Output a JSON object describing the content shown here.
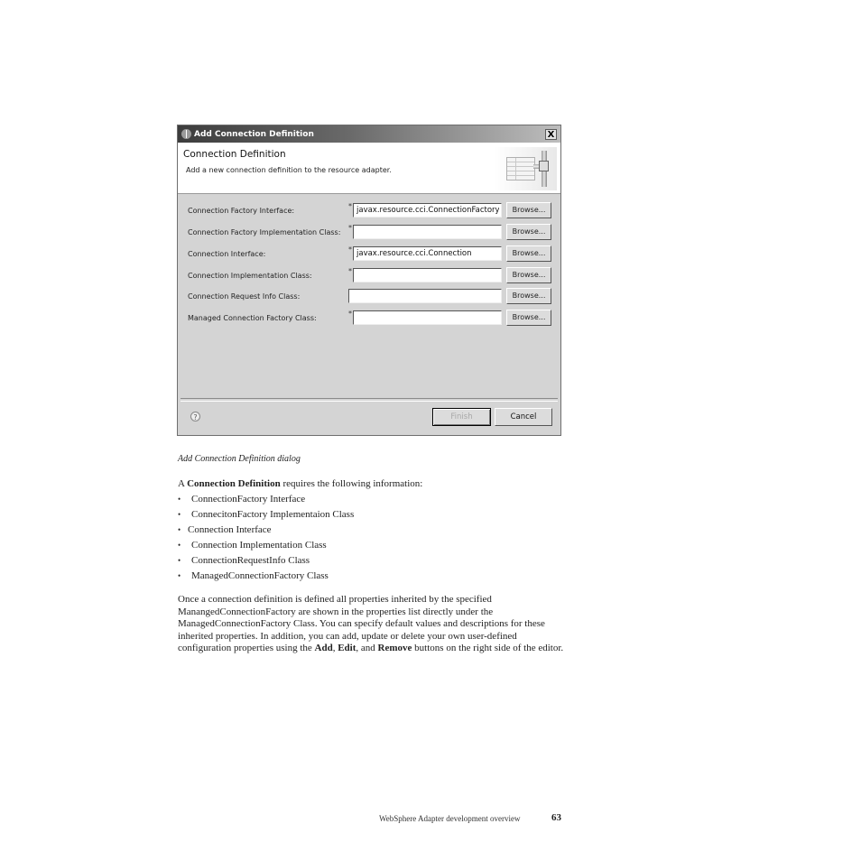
{
  "dialog": {
    "title": "Add Connection Definition",
    "close_label": "X",
    "banner": {
      "title": "Connection Definition",
      "description": "Add a new connection definition to the resource adapter."
    },
    "fields": [
      {
        "label": "Connection Factory Interface:",
        "required": true,
        "value": "javax.resource.cci.ConnectionFactory",
        "button": "Browse..."
      },
      {
        "label": "Connection Factory Implementation Class:",
        "required": true,
        "value": "",
        "button": "Browse..."
      },
      {
        "label": "Connection Interface:",
        "required": true,
        "value": "javax.resource.cci.Connection",
        "button": "Browse..."
      },
      {
        "label": "Connection Implementation Class:",
        "required": true,
        "value": "",
        "button": "Browse..."
      },
      {
        "label": "Connection Request Info Class:",
        "required": false,
        "value": "",
        "button": "Browse..."
      },
      {
        "label": "Managed Connection Factory Class:",
        "required": true,
        "value": "",
        "button": "Browse..."
      }
    ],
    "required_marker": "*",
    "help_label": "?",
    "finish_label": "Finish",
    "cancel_label": "Cancel"
  },
  "document": {
    "caption": "Add Connection Definition dialog",
    "intro_prefix": "A ",
    "intro_bold": "Connection Definition",
    "intro_suffix": " requires the following information:",
    "list": [
      "ConnectionFactory Interface",
      "ConnecitonFactory Implementaion Class",
      "Connection Interface",
      "Connection Implementation Class",
      "ConnectionRequestInfo Class",
      "ManagedConnectionFactory Class"
    ],
    "paragraph": {
      "text1": "Once a connection definition is defined all properties inherited by the specified ManangedConnectionFactory are shown in the properties list directly under the ManagedConnectionFactory Class. You can specify default values and descriptions for these inherited properties. In addition, you can add, update or delete your own user-defined configuration properties using the ",
      "bold1": "Add",
      "sep1": ", ",
      "bold2": "Edit",
      "sep2": ", and ",
      "bold3": "Remove",
      "text2": " buttons on the right side of the editor."
    },
    "footer": {
      "running_title": "WebSphere Adapter development overview",
      "page_number": "63"
    }
  }
}
